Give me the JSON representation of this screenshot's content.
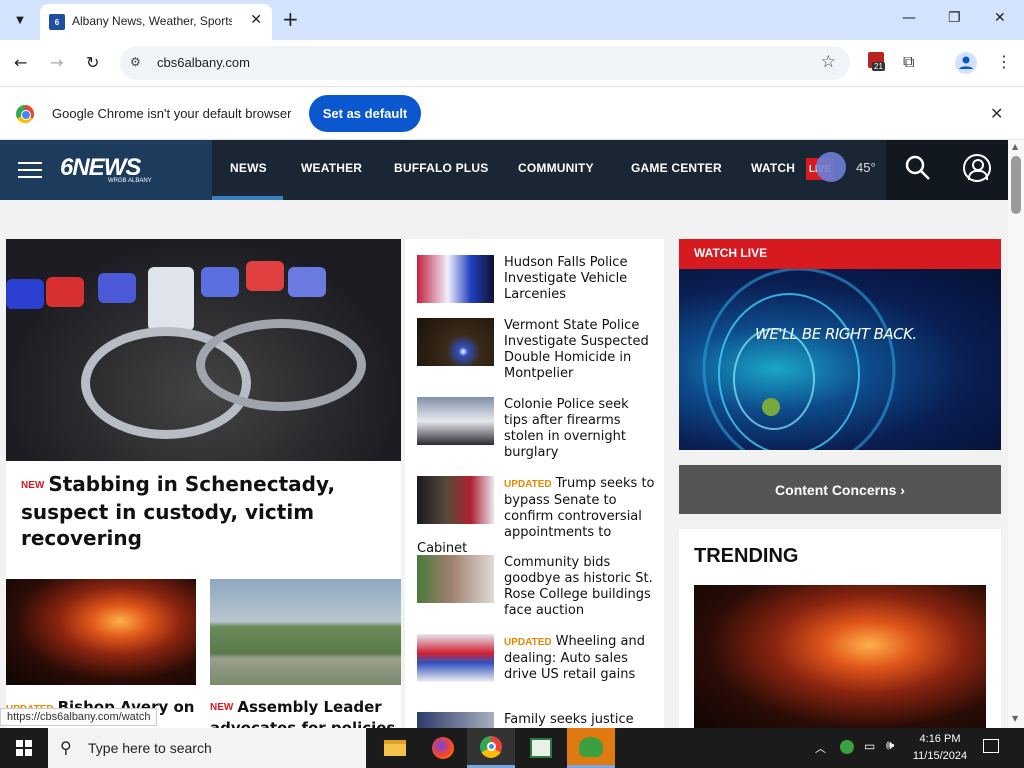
{
  "browser": {
    "tab_title": "Albany News, Weather, Sports",
    "tab_favicon": "6",
    "url": "cbs6albany.com",
    "extension_badge": "21"
  },
  "infobar": {
    "message": "Google Chrome isn't your default browser",
    "button": "Set as default"
  },
  "site": {
    "logo": "6NEWS",
    "logo_sub": "WRGB ALBANY",
    "nav": [
      "NEWS",
      "WEATHER",
      "BUFFALO PLUS",
      "COMMUNITY",
      "GAME CENTER",
      "WATCH"
    ],
    "live_badge": "LIVE",
    "temperature": "45°"
  },
  "main_story": {
    "tag": "NEW",
    "headline": "Stabbing in Schenectady, suspect in custody, victim recovering"
  },
  "sub_stories": [
    {
      "tag": "UPDATED",
      "headline": "Bishop Avery on"
    },
    {
      "tag": "NEW",
      "headline": "Assembly Leader advocates for policies"
    }
  ],
  "headlines": [
    {
      "tag": "",
      "text": "Hudson Falls Police Investigate Vehicle Larcenies"
    },
    {
      "tag": "",
      "text": "Vermont State Police Investigate Suspected Double Homicide in Montpelier"
    },
    {
      "tag": "",
      "text": "Colonie Police seek tips after firearms stolen in overnight burglary"
    },
    {
      "tag": "UPDATED",
      "text": "Trump seeks to bypass Senate to confirm controversial appointments to Cabinet"
    },
    {
      "tag": "",
      "text": "Community bids goodbye as historic St. Rose College buildings face auction"
    },
    {
      "tag": "UPDATED",
      "text": "Wheeling and dealing: Auto sales drive US retail gains"
    },
    {
      "tag": "",
      "text": "Family seeks justice"
    }
  ],
  "watch_live": {
    "header": "WATCH LIVE",
    "message": "WE'LL BE RIGHT BACK."
  },
  "content_concerns": "Content Concerns ›",
  "trending": {
    "title": "TRENDING"
  },
  "status_url": "https://cbs6albany.com/watch",
  "taskbar": {
    "search_placeholder": "Type here to search",
    "time": "4:16 PM",
    "date": "11/15/2024"
  },
  "icons": [
    "search-icon",
    "close-icon",
    "plus-icon",
    "minimize-icon",
    "maximize-icon",
    "back-arrow-icon",
    "forward-arrow-icon",
    "reload-icon",
    "site-info-icon",
    "star-icon",
    "puzzle-icon",
    "profile-icon",
    "kebab-menu-icon",
    "chrome-logo-icon",
    "hamburger-icon",
    "account-icon",
    "windows-logo-icon",
    "file-explorer-icon",
    "firefox-icon",
    "chrome-icon",
    "sheet-icon",
    "people-icon",
    "network-icon",
    "volume-icon",
    "notification-icon"
  ]
}
